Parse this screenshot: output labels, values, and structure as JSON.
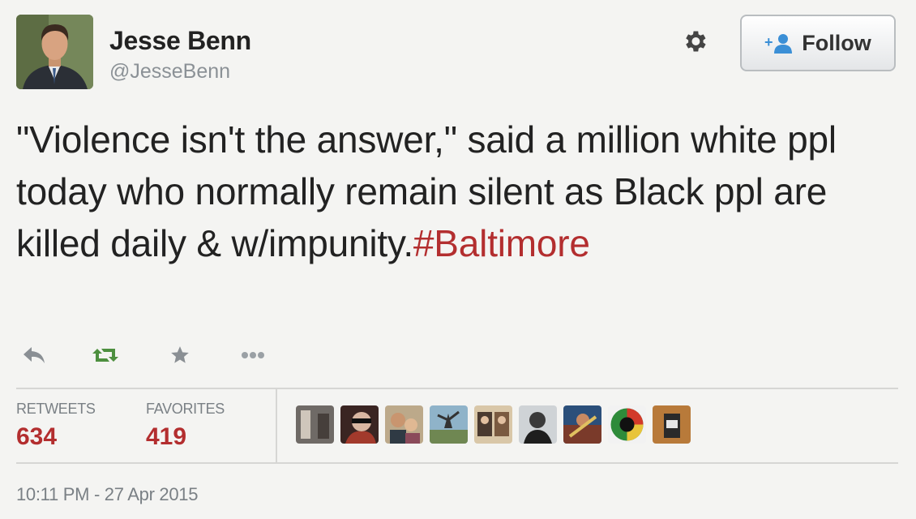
{
  "user": {
    "name": "Jesse Benn",
    "handle": "@JesseBenn",
    "avatar_icon": "profile-photo"
  },
  "header": {
    "settings_icon": "gear-icon",
    "follow_label": "Follow",
    "follow_icon": "add-person-icon"
  },
  "tweet": {
    "text_before": "\"Violence isn't the answer,\" said a million white ppl today who normally remain silent as Black ppl are killed daily & w/impunity.",
    "hashtag": "#Baltimore"
  },
  "actions": [
    "reply-icon",
    "retweet-icon",
    "favorite-star-icon",
    "more-dots-icon"
  ],
  "stats": {
    "retweets_label": "RETWEETS",
    "retweets_count": "634",
    "favorites_label": "FAVORITES",
    "favorites_count": "419"
  },
  "favoriters_count_shown": 9,
  "timestamp": "10:11 PM - 27 Apr 2015",
  "colors": {
    "accent": "#b32e2f",
    "retweet_green": "#4d8f3f",
    "muted": "#7a8085",
    "background": "#f4f4f2"
  }
}
